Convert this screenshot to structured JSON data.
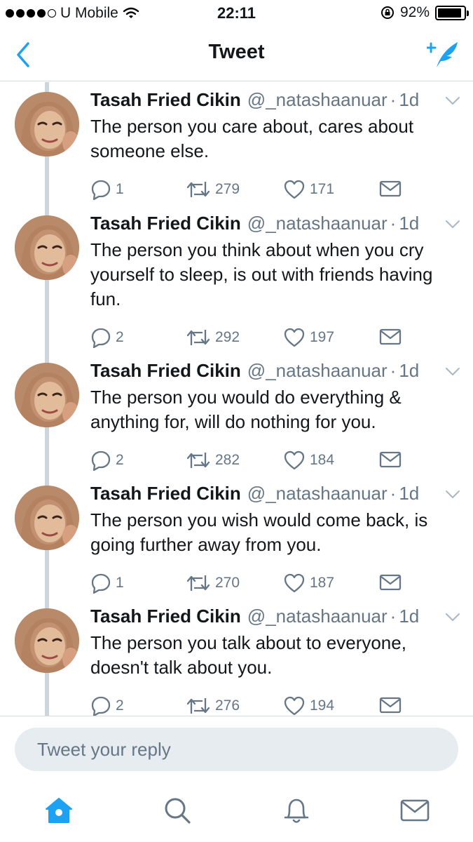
{
  "status_bar": {
    "carrier": "U Mobile",
    "time": "22:11",
    "battery": "92%",
    "battery_level": 0.92
  },
  "nav": {
    "title": "Tweet",
    "back_icon": "chevron-left-icon",
    "compose_icon": "compose-tweet-icon"
  },
  "tweets": [
    {
      "name": "Tasah Fried Cikin",
      "handle": "@_natashaanuar",
      "separator": "·",
      "time": "1d",
      "text": "The person you care about, cares about someone else.",
      "replies": "1",
      "retweets": "279",
      "likes": "171"
    },
    {
      "name": "Tasah Fried Cikin",
      "handle": "@_natashaanuar",
      "separator": "·",
      "time": "1d",
      "text": "The person you think about when you cry yourself to sleep, is out with friends having fun.",
      "replies": "2",
      "retweets": "292",
      "likes": "197"
    },
    {
      "name": "Tasah Fried Cikin",
      "handle": "@_natashaanuar",
      "separator": "·",
      "time": "1d",
      "text": "The person you would do everything & anything for, will do nothing for you.",
      "replies": "2",
      "retweets": "282",
      "likes": "184"
    },
    {
      "name": "Tasah Fried Cikin",
      "handle": "@_natashaanuar",
      "separator": "·",
      "time": "1d",
      "text": "The person you wish would come back, is going further away from you.",
      "replies": "1",
      "retweets": "270",
      "likes": "187"
    },
    {
      "name": "Tasah Fried Cikin",
      "handle": "@_natashaanuar",
      "separator": "·",
      "time": "1d",
      "text": "The person you talk about to everyone, doesn't talk about you.",
      "replies": "2",
      "retweets": "276",
      "likes": "194"
    }
  ],
  "reply": {
    "placeholder": "Tweet your reply",
    "value": ""
  },
  "tab_bar": {
    "items": [
      "home-icon",
      "search-icon",
      "notifications-icon",
      "messages-icon"
    ],
    "active": "home-icon"
  },
  "colors": {
    "accent": "#1da1f2",
    "muted": "#657786",
    "thread_line": "#ccd6dd",
    "reply_bg": "#e6ecf0"
  }
}
